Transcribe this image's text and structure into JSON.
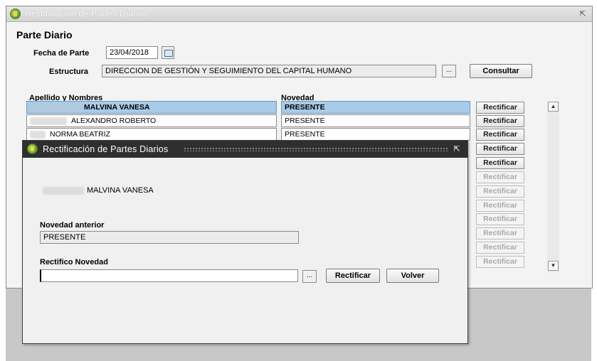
{
  "window": {
    "title": "Rectificación de Partes Diarios"
  },
  "form": {
    "section_title": "Parte Diario",
    "fecha_label": "Fecha de Parte",
    "fecha_value": "23/04/2018",
    "estructura_label": "Estructura",
    "estructura_value": "DIRECCION DE GESTIÓN Y SEGUIMIENTO DEL CAPITAL HUMANO",
    "lov_label": "...",
    "consultar_label": "Consultar"
  },
  "table": {
    "columns": [
      "Apellido y Nombres",
      "Novedad"
    ],
    "rows": [
      {
        "name": "MALVINA VANESA",
        "novedad": "PRESENTE"
      },
      {
        "name": "ALEXANDRO ROBERTO",
        "novedad": "PRESENTE"
      },
      {
        "name": "NORMA BEATRIZ",
        "novedad": "PRESENTE"
      }
    ],
    "row_button_label": "Rectificar"
  },
  "dialog": {
    "title": "Rectificación de Partes Diarios",
    "person_name": "MALVINA VANESA",
    "novedad_anterior_label": "Novedad anterior",
    "novedad_anterior_value": "PRESENTE",
    "rectifico_label": "Rectifico Novedad",
    "rectifico_value": "",
    "lov_label": "...",
    "rectificar_label": "Rectificar",
    "volver_label": "Volver"
  },
  "icons": {
    "app": "app-leaf-icon",
    "calendar": "calendar-icon",
    "scroll_up": "scroll-up-icon",
    "scroll_down": "scroll-down-icon"
  },
  "colors": {
    "selected_row": "#a7cbe8",
    "dialog_titlebar": "#2f2f2f"
  }
}
